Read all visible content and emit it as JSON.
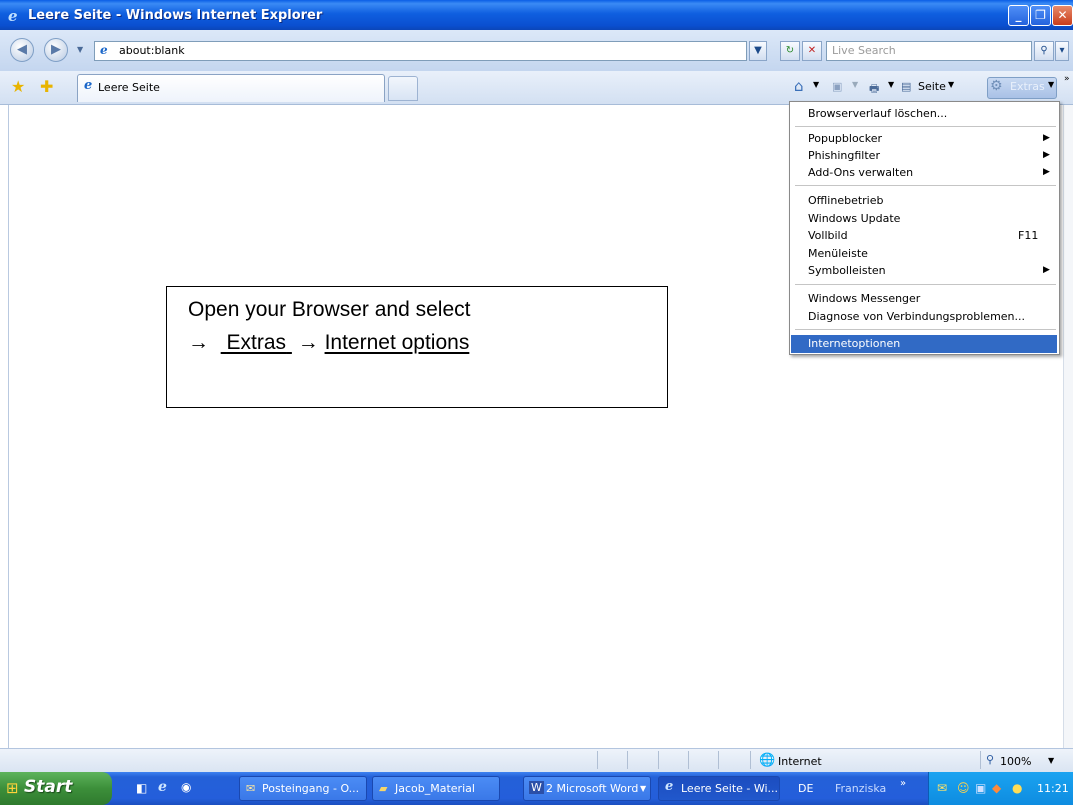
{
  "window": {
    "title": "Leere Seite - Windows Internet Explorer"
  },
  "address_bar": {
    "url": "about:blank",
    "search_placeholder": "Live Search"
  },
  "tabs": [
    {
      "label": "Leere Seite"
    }
  ],
  "toolbar": {
    "page_label": "Seite",
    "tools_label": "Extras"
  },
  "tools_menu": {
    "items": [
      {
        "label": "Browserverlauf löschen..."
      },
      {
        "label": "Popupblocker",
        "submenu": true
      },
      {
        "label": "Phishingfilter",
        "submenu": true
      },
      {
        "label": "Add-Ons verwalten",
        "submenu": true
      },
      {
        "label": "Offlinebetrieb"
      },
      {
        "label": "Windows Update"
      },
      {
        "label": "Vollbild",
        "shortcut": "F11"
      },
      {
        "label": "Menüleiste"
      },
      {
        "label": "Symbolleisten",
        "submenu": true
      },
      {
        "label": "Windows Messenger"
      },
      {
        "label": "Diagnose von Verbindungsproblemen..."
      },
      {
        "label": "Internetoptionen",
        "highlighted": true
      }
    ]
  },
  "callout": {
    "line1": "Open your Browser and  select",
    "arrow": "→",
    "extras": "Extras",
    "internet_options": "Internet options"
  },
  "status_bar": {
    "zone": "Internet",
    "zoom": "100%"
  },
  "taskbar": {
    "start_label": "Start",
    "buttons": [
      {
        "label": "Posteingang - O..."
      },
      {
        "label": "Jacob_Material"
      },
      {
        "label": "2 Microsoft Word"
      },
      {
        "label": "Leere Seite - Wi...",
        "active": true
      },
      {
        "label": "Franziska"
      }
    ],
    "language": "DE",
    "clock": "11:21"
  },
  "colors": {
    "titlebar": "#0a5ee6",
    "menu_highlight": "#316ac5",
    "taskbar": "#245edb",
    "start_button": "#3c8f3a"
  }
}
